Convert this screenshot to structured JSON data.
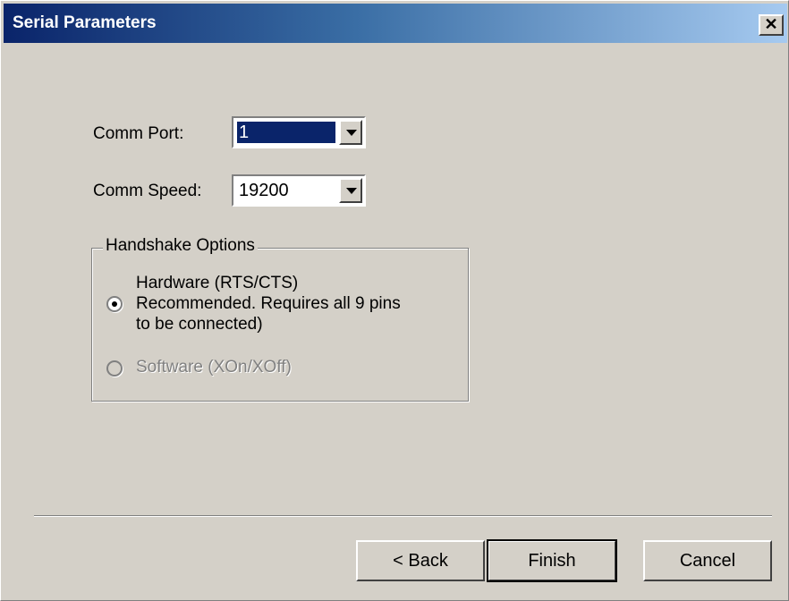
{
  "window": {
    "title": "Serial Parameters",
    "close_glyph": "✕"
  },
  "form": {
    "comm_port_label": "Comm Port:",
    "comm_port_value": "1",
    "comm_speed_label": "Comm Speed:",
    "comm_speed_value": "19200"
  },
  "handshake": {
    "legend": "Handshake Options",
    "hardware": {
      "line1": "Hardware (RTS/CTS)",
      "line2": "Recommended.  Requires all 9 pins",
      "line3": "to be connected)",
      "selected": true
    },
    "software": {
      "label": "Software (XOn/XOff)",
      "enabled": false
    }
  },
  "buttons": {
    "back": "< Back",
    "finish": "Finish",
    "cancel": "Cancel"
  }
}
